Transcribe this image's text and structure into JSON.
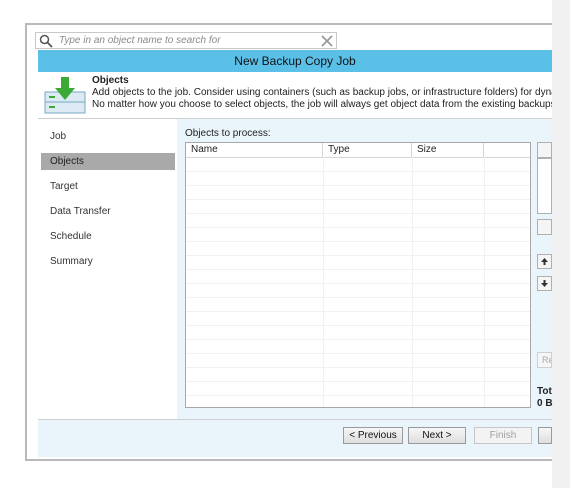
{
  "search": {
    "placeholder": "Type in an object name to search for"
  },
  "window": {
    "title": "New Backup Copy Job"
  },
  "header": {
    "title": "Objects",
    "desc_line1": "Add objects to the job. Consider using containers (such as backup jobs, or infrastructure folders) for dynamic select",
    "desc_line2": "No matter how you choose to select objects, the job will always get object data from the existing backups files."
  },
  "nav": {
    "items": [
      {
        "label": "Job"
      },
      {
        "label": "Objects",
        "selected": true
      },
      {
        "label": "Target"
      },
      {
        "label": "Data Transfer"
      },
      {
        "label": "Schedule"
      },
      {
        "label": "Summary"
      }
    ]
  },
  "objects": {
    "label": "Objects to process:",
    "columns": [
      "Name",
      "Type",
      "Size"
    ]
  },
  "side": {
    "remove_partial": "Re",
    "total_label": "Tot",
    "total_value": "0 B"
  },
  "footer": {
    "previous": "< Previous",
    "next": "Next >",
    "finish": "Finish"
  },
  "colors": {
    "titlebar": "#5bc0e8",
    "content_bg": "#eaf4fb",
    "selected_nav": "#a9a9a9",
    "icon_green": "#3aa935"
  },
  "icons": {
    "search": "search-icon",
    "clear": "close-icon",
    "header": "objects-download-icon"
  }
}
